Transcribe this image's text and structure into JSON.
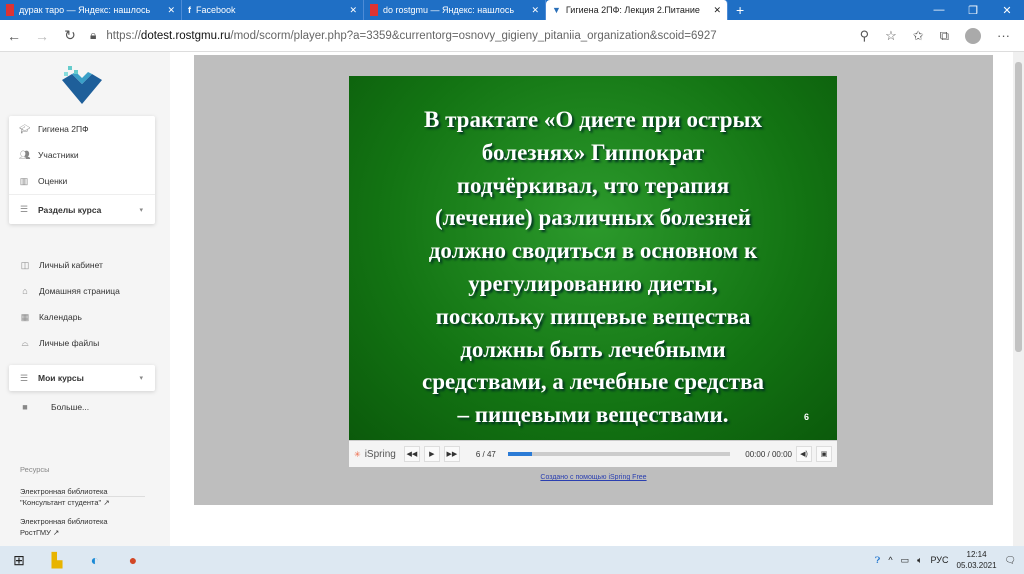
{
  "browser": {
    "tabs": [
      {
        "title": "дурак таро — Яндекс: нашлось",
        "color": "#d33"
      },
      {
        "title": "Facebook",
        "color": "#1877f2"
      },
      {
        "title": "do rostgmu — Яндекс: нашлось",
        "color": "#d33"
      },
      {
        "title": "Гигиена 2ПФ: Лекция 2.Питание",
        "color": "#2a6fb8"
      }
    ],
    "url_prefix": "https://",
    "url_domain": "dotest.rostgmu.ru",
    "url_path": "/mod/scorm/player.php?a=3359&currentorg=osnovy_gigieny_pitaniia_organization&scoid=6927"
  },
  "sidebar": {
    "course_items": [
      "Гигиена 2ПФ",
      "Участники",
      "Оценки"
    ],
    "sections_label": "Разделы курса",
    "nav_items": [
      "Личный кабинет",
      "Домашняя страница",
      "Календарь",
      "Личные файлы"
    ],
    "my_courses": "Мои курсы",
    "more": "Больше...",
    "resources_title": "Ресурсы",
    "resources": [
      {
        "line1": "Электронная библиотека",
        "line2": "\"Консультант студента\""
      },
      {
        "line1": "Электронная библиотека",
        "line2": "РостГМУ"
      }
    ]
  },
  "slide": {
    "lines": [
      "В трактате «О диете при острых",
      "болезнях» Гиппократ",
      "подчёркивал, что терапия",
      "(лечение) различных болезней",
      "должно сводиться в основном к",
      "урегулированию диеты,",
      "поскольку пищевые вещества",
      "должны быть лечебными",
      "средствами, а лечебные средства",
      "– пищевыми веществами."
    ],
    "number": "6"
  },
  "player": {
    "brand": "iSpring",
    "slide_counter": "6 / 47",
    "progress_percent": 11,
    "time": "00:00 / 00:00",
    "credit": "Создано с помощью iSpring Free"
  },
  "taskbar": {
    "lang": "РУС",
    "time": "12:14",
    "date": "05.03.2021"
  }
}
